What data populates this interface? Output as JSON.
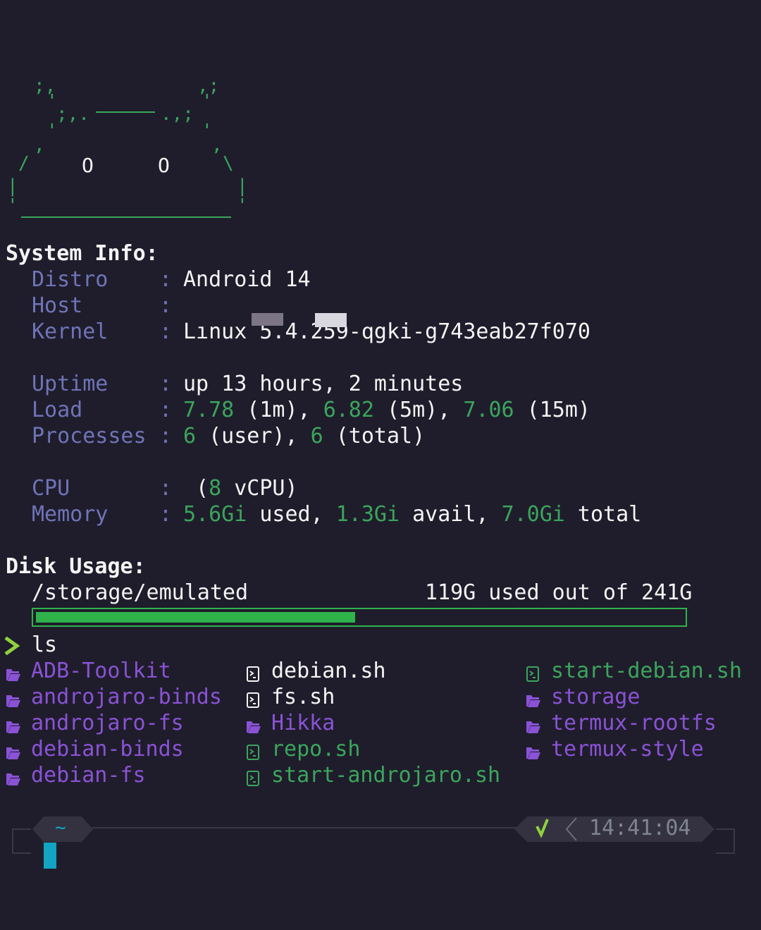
{
  "ascii_art": {
    "eye_left": "O",
    "eye_right": "O"
  },
  "system_info": {
    "heading": "System Info:",
    "rows": [
      {
        "label": "Distro",
        "sep": ":",
        "value": "Android 14"
      },
      {
        "label": "Host",
        "sep": ":",
        "value": ""
      },
      {
        "label": "Kernel",
        "sep": ":",
        "value": "Lınux 5.4.259-qgki-g743eab27f070"
      },
      {
        "label": "Uptime",
        "sep": ":",
        "value": "up 13 hours, 2 minutes"
      },
      {
        "label": "Load",
        "sep": ":",
        "v1": "7.78",
        "t1": " (1m), ",
        "v2": "6.82",
        "t2": " (5m), ",
        "v3": "7.06",
        "t3": " (15m)"
      },
      {
        "label": "Processes",
        "sep": ":",
        "v1": "6",
        "t1": " (user), ",
        "v2": "6",
        "t2": " (total)"
      },
      {
        "label": "CPU",
        "sep": ":",
        "t0": " (",
        "v1": "8",
        "t1": " vCPU)"
      },
      {
        "label": "Memory",
        "sep": ":",
        "v1": "5.6Gi",
        "t1": " used, ",
        "v2": "1.3Gi",
        "t2": " avail, ",
        "v3": "7.0Gi",
        "t3": " total"
      }
    ]
  },
  "disk_usage": {
    "heading": "Disk Usage:",
    "mount": "/storage/emulated",
    "summary": "119G used out of 241G",
    "used_fraction": 0.494
  },
  "command": {
    "prompt_icon": "chevron-right-icon",
    "text": "ls"
  },
  "ls_output": {
    "col1": [
      {
        "name": "ADB-Toolkit",
        "type": "dir"
      },
      {
        "name": "androjaro-binds",
        "type": "dir"
      },
      {
        "name": "androjaro-fs",
        "type": "dir"
      },
      {
        "name": "debian-binds",
        "type": "dir"
      },
      {
        "name": "debian-fs",
        "type": "dir"
      }
    ],
    "col2": [
      {
        "name": "debian.sh",
        "type": "file"
      },
      {
        "name": "fs.sh",
        "type": "file"
      },
      {
        "name": "Hikka",
        "type": "dir"
      },
      {
        "name": "repo.sh",
        "type": "exec"
      },
      {
        "name": "start-androjaro.sh",
        "type": "exec"
      }
    ],
    "col3": [
      {
        "name": "start-debian.sh",
        "type": "exec"
      },
      {
        "name": "storage",
        "type": "dir"
      },
      {
        "name": "termux-rootfs",
        "type": "dir"
      },
      {
        "name": "termux-style",
        "type": "dir"
      }
    ]
  },
  "status_bar": {
    "cwd": "~",
    "status_icon": "checkmark-icon",
    "time": "14:41:04"
  },
  "colors": {
    "background": "#1f1d2b",
    "green": "#3ba55c",
    "label": "#6f74b8",
    "directory": "#8a52d6",
    "cursor": "#12a4c2"
  }
}
